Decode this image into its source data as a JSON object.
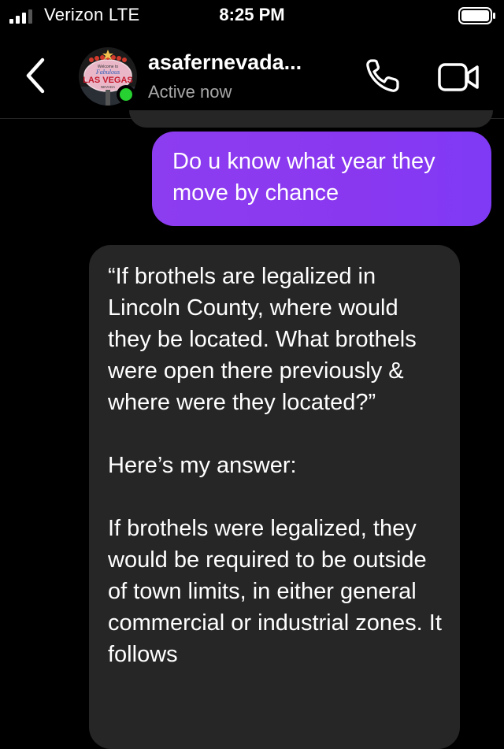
{
  "status_bar": {
    "carrier": "Verizon  LTE",
    "time": "8:25 PM",
    "signal_icon": "signal-bars-icon",
    "battery_icon": "battery-icon"
  },
  "header": {
    "contact_name": "asafernevada...",
    "presence": "Active now",
    "avatar_text": {
      "line1": "Welcome to",
      "line2": "Fabulous",
      "line3": "LAS VEGAS",
      "line4": "NEVADA"
    },
    "icons": [
      "back-chevron-icon",
      "phone-icon",
      "video-camera-icon"
    ],
    "online_color": "#26d131"
  },
  "messages": {
    "sent_1": "Do u know what year they move by chance",
    "received_1": {
      "para1": "“If brothels are legalized in Lincoln County, where would they be located. What brothels were open there previously & where were they located?”",
      "para2": "Here’s my answer:",
      "para3": "If brothels were legalized, they would be required to be outside of town limits, in either general commercial or industrial zones. It follows"
    },
    "sent_color": "#8a38f0",
    "received_color": "#262626"
  }
}
